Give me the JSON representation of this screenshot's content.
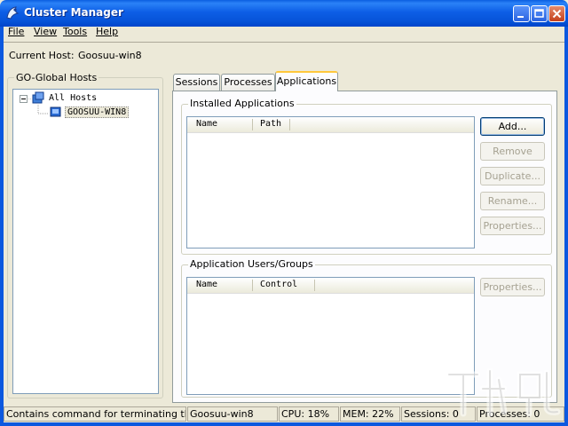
{
  "window": {
    "title": "Cluster Manager"
  },
  "menu": [
    "File",
    "View",
    "Tools",
    "Help"
  ],
  "current_host": {
    "label": "Current Host:",
    "value": "Goosuu-win8"
  },
  "hosts_panel": {
    "title": "GO-Global Hosts",
    "tree": {
      "root": "All Hosts",
      "child": "GOOSUU-WIN8"
    }
  },
  "tabs": [
    "Sessions",
    "Processes",
    "Applications"
  ],
  "active_tab": "Applications",
  "installed_apps": {
    "title": "Installed Applications",
    "columns": [
      "Name",
      "Path"
    ],
    "buttons": [
      "Add...",
      "Remove",
      "Duplicate...",
      "Rename...",
      "Properties..."
    ]
  },
  "app_users": {
    "title": "Application Users/Groups",
    "columns": [
      "Name",
      "Control"
    ],
    "buttons": [
      "Properties..."
    ]
  },
  "status_bar": {
    "message": "Contains command for terminating this app",
    "host": "Goosuu-win8",
    "cpu": "CPU: 18%",
    "mem": "MEM: 22%",
    "sessions": "Sessions: 0",
    "processes": "Processes: 0"
  },
  "colors": {
    "titlebar": "#0d5ee6",
    "face": "#ece9d8",
    "active_tab_accent": "#ffc83c"
  }
}
